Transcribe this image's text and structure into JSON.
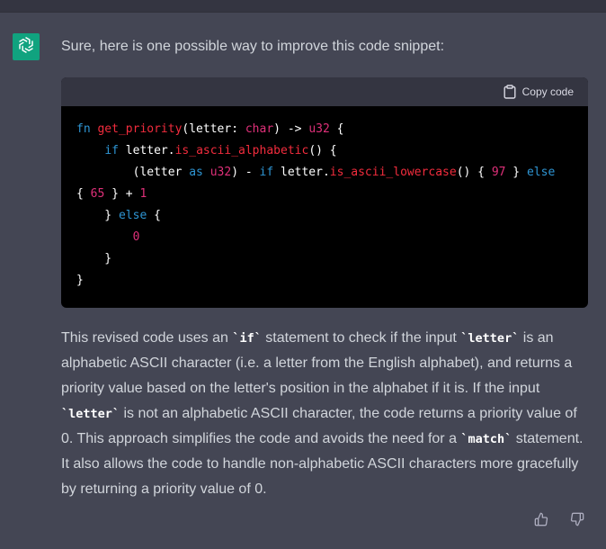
{
  "message": {
    "intro": "Sure, here is one possible way to improve this code snippet:",
    "code_block": {
      "copy_label": "Copy code",
      "lines": [
        [
          {
            "t": "fn",
            "c": "kw"
          },
          {
            "t": " "
          },
          {
            "t": "get_priority",
            "c": "fnc"
          },
          {
            "t": "(letter: "
          },
          {
            "t": "char",
            "c": "ty"
          },
          {
            "t": ") -> "
          },
          {
            "t": "u32",
            "c": "ty"
          },
          {
            "t": " {"
          }
        ],
        [
          {
            "t": "    "
          },
          {
            "t": "if",
            "c": "kw"
          },
          {
            "t": " letter."
          },
          {
            "t": "is_ascii_alphabetic",
            "c": "fnc"
          },
          {
            "t": "() {"
          }
        ],
        [
          {
            "t": "        (letter "
          },
          {
            "t": "as",
            "c": "kw"
          },
          {
            "t": " "
          },
          {
            "t": "u32",
            "c": "ty"
          },
          {
            "t": ") - "
          },
          {
            "t": "if",
            "c": "kw"
          },
          {
            "t": " letter."
          },
          {
            "t": "is_ascii_lowercase",
            "c": "fnc"
          },
          {
            "t": "() { "
          },
          {
            "t": "97",
            "c": "num"
          },
          {
            "t": " } "
          },
          {
            "t": "else",
            "c": "kw"
          }
        ],
        [
          {
            "t": "{ "
          },
          {
            "t": "65",
            "c": "num"
          },
          {
            "t": " } + "
          },
          {
            "t": "1",
            "c": "num"
          }
        ],
        [
          {
            "t": "    } "
          },
          {
            "t": "else",
            "c": "kw"
          },
          {
            "t": " {"
          }
        ],
        [
          {
            "t": "        "
          },
          {
            "t": "0",
            "c": "num"
          }
        ],
        [
          {
            "t": "    }"
          }
        ],
        [
          {
            "t": "}"
          }
        ]
      ]
    },
    "explanation": {
      "p1": "This revised code uses an ",
      "c1": "`if`",
      "p2": " statement to check if the input ",
      "c2": "`letter`",
      "p3": " is an alphabetic ASCII character (i.e. a letter from the English alphabet), and returns a priority value based on the letter's position in the alphabet if it is. If the input ",
      "c3": "`letter`",
      "p4": " is not an alphabetic ASCII character, the code returns a priority value of 0. This approach simplifies the code and avoids the need for a ",
      "c4": "`match`",
      "p5": " statement. It also allows the code to handle non-alphabetic ASCII characters more gracefully by returning a priority value of 0."
    }
  },
  "icons": {
    "avatar": "openai-logo-icon",
    "copy": "clipboard-icon",
    "thumb_up": "thumbs-up-icon",
    "thumb_down": "thumbs-down-icon"
  },
  "colors": {
    "page_bg": "#444654",
    "avatar_bg": "#10a37f",
    "code_header_bg": "#343541",
    "code_bg": "#000000",
    "keyword": "#2e95d3",
    "function": "#f22c3d",
    "type_number": "#df3079"
  }
}
